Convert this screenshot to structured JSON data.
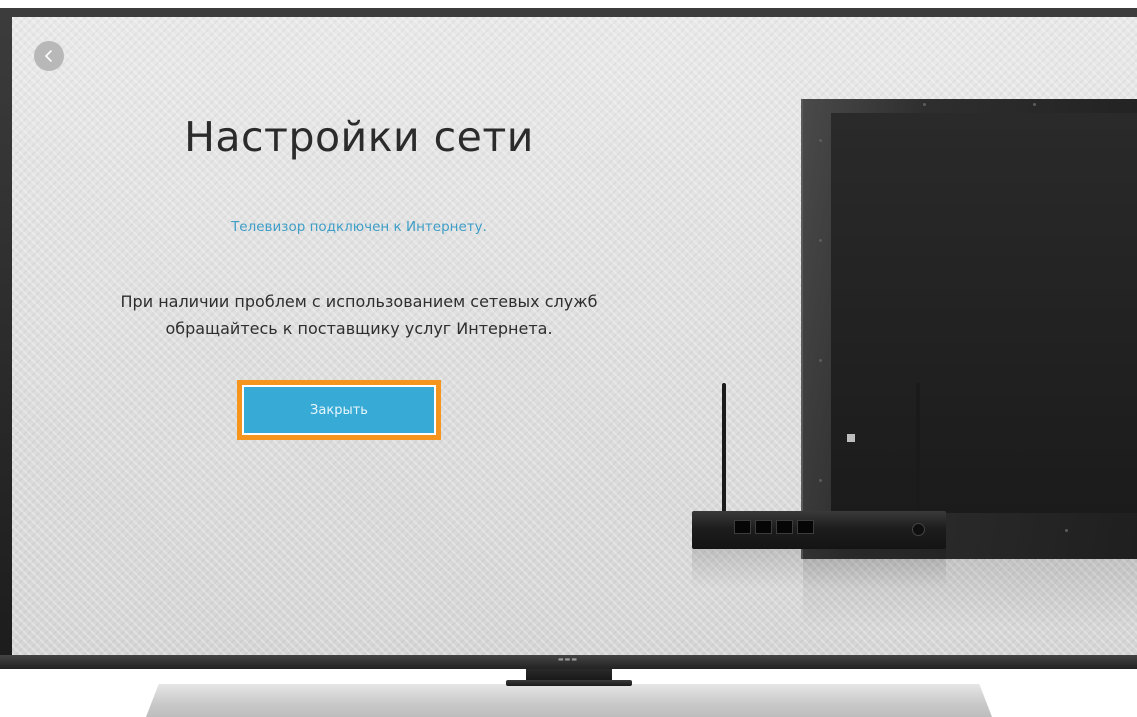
{
  "screen": {
    "title": "Настройки сети",
    "status": "Телевизор подключен к Интернету.",
    "info": "При наличии проблем с использованием сетевых служб обращайтесь к поставщику услуг Интернета.",
    "close_label": "Закрыть"
  },
  "icons": {
    "back": "chevron-left-icon"
  },
  "colors": {
    "focus_border": "#f5951e",
    "button_fill": "#38aad6",
    "status_text": "#3e9ec7"
  }
}
